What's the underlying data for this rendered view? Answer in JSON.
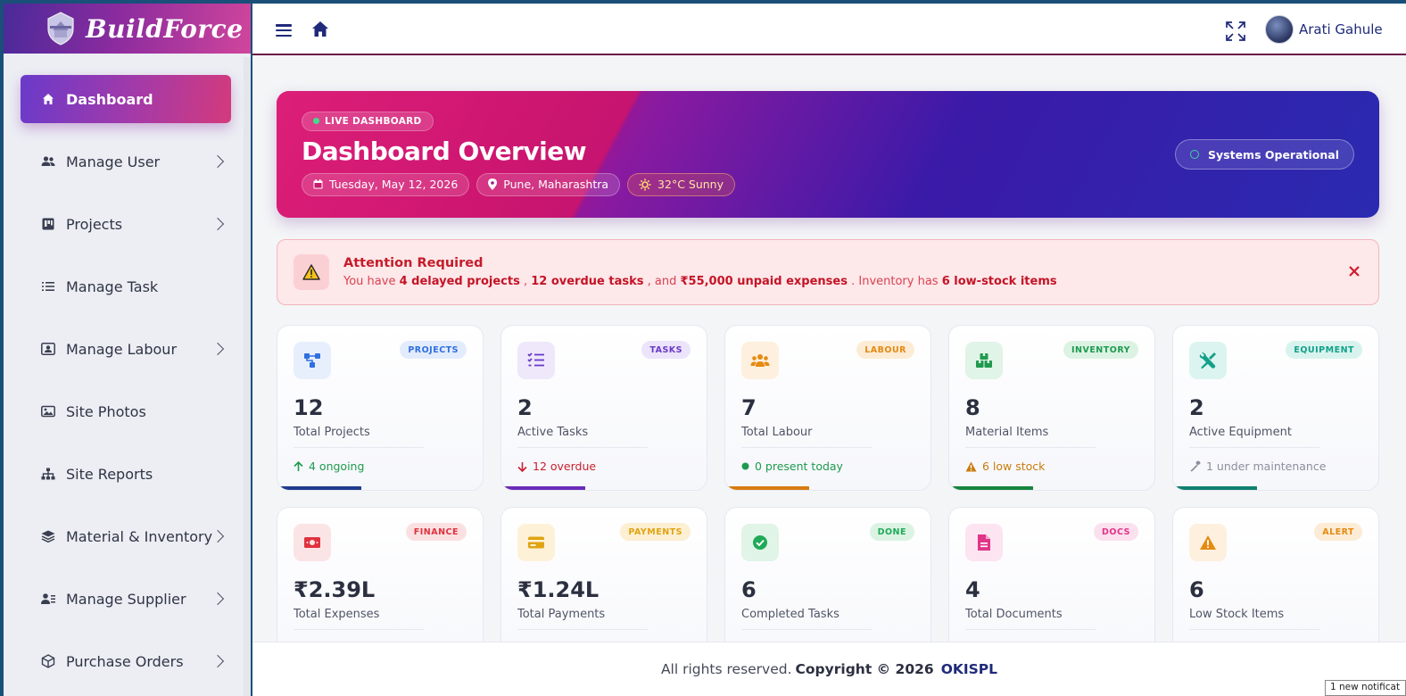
{
  "brand": {
    "name": "BuildForce",
    "logo_icon": "crest-logo-icon"
  },
  "sidebar": {
    "items": [
      {
        "label": "Dashboard",
        "icon": "home-icon",
        "active": true
      },
      {
        "label": "Manage User",
        "icon": "users-icon",
        "has_submenu": true
      },
      {
        "label": "Projects",
        "icon": "project-board-icon",
        "has_submenu": true
      },
      {
        "label": "Manage Task",
        "icon": "list-icon",
        "has_submenu": false
      },
      {
        "label": "Manage Labour",
        "icon": "id-card-icon",
        "has_submenu": true
      },
      {
        "label": "Site Photos",
        "icon": "image-icon",
        "has_submenu": false
      },
      {
        "label": "Site Reports",
        "icon": "sitemap-icon",
        "has_submenu": false
      },
      {
        "label": "Material & Inventory",
        "icon": "layers-icon",
        "has_submenu": true
      },
      {
        "label": "Manage Supplier",
        "icon": "user-list-icon",
        "has_submenu": true
      },
      {
        "label": "Purchase Orders",
        "icon": "box-icon",
        "has_submenu": true
      }
    ]
  },
  "topbar": {
    "user_name": "Arati Gahule"
  },
  "hero": {
    "badge": "LIVE DASHBOARD",
    "title": "Dashboard Overview",
    "date": "Tuesday, May 12, 2026",
    "location": "Pune, Maharashtra",
    "weather": "32°C Sunny",
    "status": "Systems Operational"
  },
  "alert": {
    "title": "Attention Required",
    "part1": "You have ",
    "delayed": "4 delayed projects",
    "part2": " , ",
    "overdue": "12 overdue tasks",
    "part3": " , and ",
    "unpaid": "₹55,000 unpaid expenses",
    "part4": " . Inventory has ",
    "lowstock": "6 low-stock items"
  },
  "cards": [
    {
      "tag": "PROJECTS",
      "value": "12",
      "label": "Total Projects",
      "foot": "4 ongoing",
      "color": "#2f6fe0",
      "tag_bg": "#e3ecfc",
      "icon_bg": "#e8effc",
      "foot_color": "#1e9a4e",
      "bar": "#1f3b8c",
      "icon": "project-nodes-icon",
      "foot_icon": "arrow-up-icon"
    },
    {
      "tag": "TASKS",
      "value": "2",
      "label": "Active Tasks",
      "foot": "12 overdue",
      "color": "#6a3ac8",
      "tag_bg": "#ece4fa",
      "icon_bg": "#efe8fb",
      "foot_color": "#c8202e",
      "bar": "#6a2ab8",
      "icon": "checklist-icon",
      "foot_icon": "arrow-down-icon"
    },
    {
      "tag": "LABOUR",
      "value": "7",
      "label": "Total Labour",
      "foot": "0 present today",
      "color": "#e58a12",
      "tag_bg": "#fcecd6",
      "icon_bg": "#fdf0de",
      "foot_color": "#1e9a4e",
      "bar": "#d87a10",
      "icon": "people-icon",
      "foot_icon": "green-dot-icon"
    },
    {
      "tag": "INVENTORY",
      "value": "8",
      "label": "Material Items",
      "foot": "6 low stock",
      "color": "#1f9a4e",
      "tag_bg": "#dcf3e4",
      "icon_bg": "#e0f4e7",
      "foot_color": "#c97b0c",
      "bar": "#16843e",
      "icon": "boxes-icon",
      "foot_icon": "warning-icon"
    },
    {
      "tag": "EQUIPMENT",
      "value": "2",
      "label": "Active Equipment",
      "foot": "1 under maintenance",
      "color": "#12a08a",
      "tag_bg": "#d8f3ee",
      "icon_bg": "#dcf4ef",
      "foot_color": "#8a8f9c",
      "bar": "#0f7f6e",
      "icon": "tools-icon",
      "foot_icon": "wrench-icon"
    },
    {
      "tag": "FINANCE",
      "value": "₹2.39L",
      "label": "Total Expenses",
      "color": "#e0323f",
      "tag_bg": "#fbe0e2",
      "icon_bg": "#fbe4e6",
      "icon": "money-icon"
    },
    {
      "tag": "PAYMENTS",
      "value": "₹1.24L",
      "label": "Total Payments",
      "color": "#e0a412",
      "tag_bg": "#fcefd2",
      "icon_bg": "#fdf2d8",
      "icon": "card-icon"
    },
    {
      "tag": "DONE",
      "value": "6",
      "label": "Completed Tasks",
      "color": "#1faa58",
      "tag_bg": "#dcf3e4",
      "icon_bg": "#e0f4e7",
      "icon": "check-circle-icon"
    },
    {
      "tag": "DOCS",
      "value": "4",
      "label": "Total Documents",
      "color": "#e0358a",
      "tag_bg": "#fbe0ee",
      "icon_bg": "#fce4f0",
      "icon": "document-icon"
    },
    {
      "tag": "ALERT",
      "value": "6",
      "label": "Low Stock Items",
      "color": "#e58a12",
      "tag_bg": "#fcecd6",
      "icon_bg": "#fdf0de",
      "icon": "alert-triangle-icon"
    }
  ],
  "footer": {
    "text": "All rights reserved.",
    "copyright": "Copyright © 2026",
    "org": "OKISPL"
  },
  "toast": "1 new notificat"
}
